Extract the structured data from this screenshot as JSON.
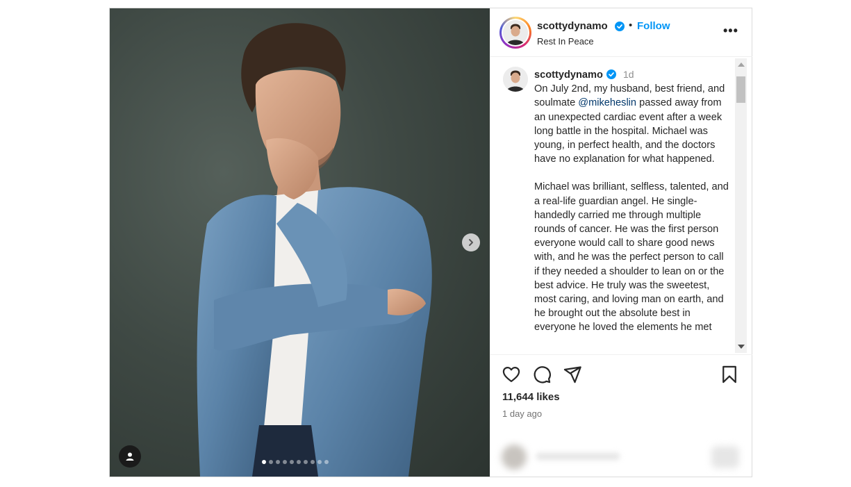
{
  "header": {
    "username": "scottydynamo",
    "bullet": "•",
    "follow_label": "Follow",
    "subtitle": "Rest In Peace",
    "more_label": "•••"
  },
  "caption": {
    "username": "scottydynamo",
    "time": "1d",
    "p1_before": "On July 2nd, my husband, best friend, and soulmate ",
    "mention": "@mikeheslin",
    "p1_after": " passed away from an unexpected cardiac event after a week long battle in the hospital. Michael was young, in perfect health, and the doctors have no explanation for what happened.",
    "p2": "Michael was brilliant, selfless, talented, and a real-life guardian angel. He single-handedly carried me through multiple rounds of cancer. He was the first person everyone would call to share good news with, and he was the perfect person to call if they needed a shoulder to lean on or the best advice. He truly was the sweetest, most caring, and loving man on earth, and he brought out the absolute best in everyone he loved the elements he met"
  },
  "stats": {
    "likes": "11,644 likes",
    "ago": "1 day ago"
  },
  "carousel": {
    "total_slides": 10,
    "active_slide": 1
  },
  "icons": {
    "like": "heart-icon",
    "comment": "comment-icon",
    "share": "share-icon",
    "save": "bookmark-icon",
    "next": "chevron-right-icon",
    "tag": "user-tag-icon",
    "verified": "verified-badge-icon"
  },
  "colors": {
    "link_blue": "#0095f6",
    "mention_blue": "#00376b",
    "text": "#262626",
    "muted": "#737373"
  }
}
